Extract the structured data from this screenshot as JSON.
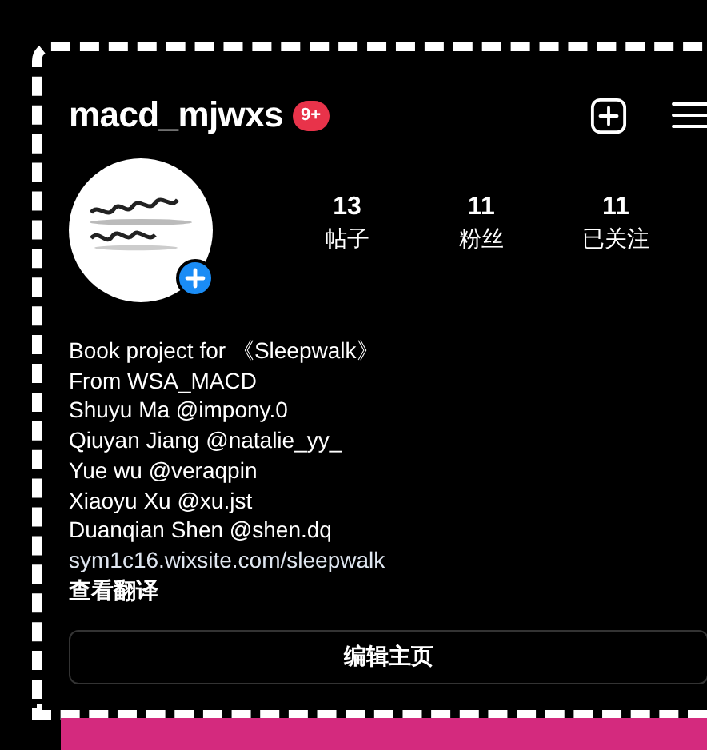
{
  "header": {
    "username": "macd_mjwxs",
    "badge": "9+"
  },
  "profile": {
    "stats": [
      {
        "value": "13",
        "label": "帖子"
      },
      {
        "value": "11",
        "label": "粉丝"
      },
      {
        "value": "11",
        "label": "已关注"
      }
    ]
  },
  "bio": [
    {
      "kind": "text",
      "text": "Book project for 《Sleepwalk》"
    },
    {
      "kind": "text",
      "text": "From WSA_MACD"
    },
    {
      "kind": "text",
      "text": "Shuyu Ma @impony.0"
    },
    {
      "kind": "text",
      "text": "Qiuyan Jiang @natalie_yy_"
    },
    {
      "kind": "text",
      "text": "Yue wu @veraqpin"
    },
    {
      "kind": "text",
      "text": "Xiaoyu Xu @xu.jst"
    },
    {
      "kind": "text",
      "text": "Duanqian Shen @shen.dq"
    },
    {
      "kind": "link",
      "text": "sym1c16.wixsite.com/sleepwalk"
    },
    {
      "kind": "translate",
      "text": "查看翻译"
    }
  ],
  "edit_button": {
    "label": "编辑主页"
  }
}
